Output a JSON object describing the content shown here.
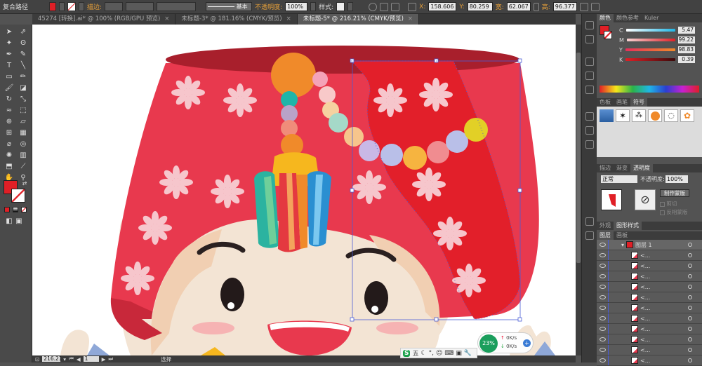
{
  "topbar": {
    "object_label": "复合路径",
    "stroke_label": "描边:",
    "brush_label": "基本",
    "opacity_label": "不透明度:",
    "opacity_value": "100%",
    "style_label": "样式:",
    "x_label": "X:",
    "x_value": "158.606",
    "y_label": "Y:",
    "y_value": "80.259",
    "w_label": "宽:",
    "w_value": "62.067",
    "h_label": "高:",
    "h_value": "96.377",
    "fill_color": "#e01f26"
  },
  "tabs": [
    {
      "label": "45274 [转换].ai* @ 100% (RGB/GPU 预览)",
      "active": false
    },
    {
      "label": "未标题-3* @ 181.16% (CMYK/预览)",
      "active": false
    },
    {
      "label": "未标题-5* @ 216.21% (CMYK/预览)",
      "active": true
    }
  ],
  "status": {
    "zoom": "216.21",
    "artboard": "1",
    "tool_status": "选择"
  },
  "color_panel": {
    "tabs": [
      "颜色",
      "颜色参考",
      "Kuler"
    ],
    "channels": [
      {
        "label": "C",
        "value": "5.47",
        "color": "#1fb6e6"
      },
      {
        "label": "M",
        "value": "99.22",
        "color": "#e63a8f"
      },
      {
        "label": "Y",
        "value": "98.83",
        "color": "#f3e81a"
      },
      {
        "label": "K",
        "value": "0.39",
        "color": "#333333"
      }
    ],
    "fill_color": "#e01f26"
  },
  "swatch_panel": {
    "tabs": [
      "色板",
      "画笔",
      "符号"
    ]
  },
  "transparency_panel": {
    "tabs": [
      "描边",
      "渐变",
      "透明度"
    ],
    "blend_mode": "正常",
    "opacity_label": "不透明度:",
    "opacity_value": "100%",
    "make_mask_label": "制作蒙版",
    "clip_label": "剪切",
    "invert_label": "反相蒙版"
  },
  "appearance_panel": {
    "tabs": [
      "外观",
      "图形样式"
    ]
  },
  "layers_panel": {
    "tabs": [
      "图层",
      "画板"
    ],
    "top_layer_label": "图层 1",
    "sublayer_label": "<...",
    "sublayer_count": 11
  },
  "network": {
    "percent": "23%",
    "up": "0K/s",
    "down": "0K/s"
  },
  "ime": {
    "logo": "S",
    "mode": "五"
  },
  "colors": {
    "hat_red": "#e8394e",
    "hat_dark": "#a81f2c",
    "selected_red": "#e21f2a",
    "flower": "#f6c6cc",
    "face": "#f3e4d4",
    "hair": "#f1cfb2",
    "selection_blue": "#4a5cd6"
  }
}
